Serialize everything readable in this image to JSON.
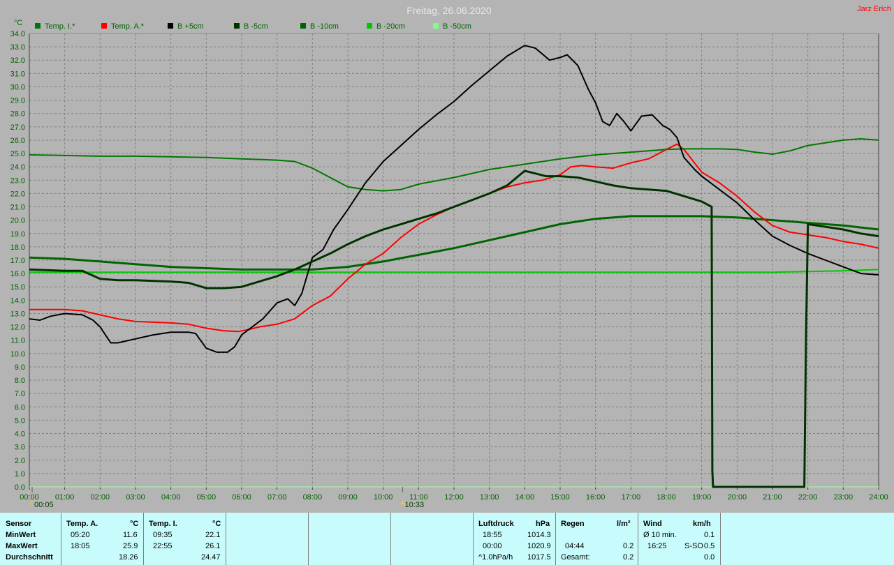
{
  "title": "Freitag, 26.06.2020",
  "author": "Jarz Erich",
  "colors": {
    "background": "#b4b4b4",
    "grid": "#808080",
    "axis_text": "#006400",
    "title_text": "#e8e8e8",
    "author_text": "#ff0000",
    "panel_bg": "#c8fcfc"
  },
  "chart_data": {
    "type": "line",
    "unit_label": "°C",
    "ylim": [
      0,
      34
    ],
    "y_ticks": [
      "0.0",
      "1.0",
      "2.0",
      "3.0",
      "4.0",
      "5.0",
      "6.0",
      "7.0",
      "8.0",
      "9.0",
      "10.0",
      "11.0",
      "12.0",
      "13.0",
      "14.0",
      "15.0",
      "16.0",
      "17.0",
      "18.0",
      "19.0",
      "20.0",
      "21.0",
      "22.0",
      "23.0",
      "24.0",
      "25.0",
      "26.0",
      "27.0",
      "28.0",
      "29.0",
      "30.0",
      "31.0",
      "32.0",
      "33.0",
      "34.0"
    ],
    "xlim": [
      0,
      24
    ],
    "x_ticks": [
      "00:00",
      "01:00",
      "02:00",
      "03:00",
      "04:00",
      "05:00",
      "06:00",
      "07:00",
      "08:00",
      "09:00",
      "10:00",
      "11:00",
      "12:00",
      "13:00",
      "14:00",
      "15:00",
      "16:00",
      "17:00",
      "18:00",
      "19:00",
      "20:00",
      "21:00",
      "22:00",
      "23:00",
      "24:00"
    ],
    "grid": true,
    "legend_position": "top",
    "markers": [
      {
        "label": "00:05",
        "x": 0.08
      },
      {
        "label": "10:33",
        "x": 10.55
      }
    ],
    "series": [
      {
        "name": "Temp. I.*",
        "color": "#007800",
        "width": 2,
        "points": [
          [
            0,
            24.9
          ],
          [
            1,
            24.85
          ],
          [
            2,
            24.8
          ],
          [
            3,
            24.8
          ],
          [
            4,
            24.75
          ],
          [
            5,
            24.7
          ],
          [
            6,
            24.6
          ],
          [
            7,
            24.5
          ],
          [
            7.5,
            24.4
          ],
          [
            8,
            23.9
          ],
          [
            8.5,
            23.2
          ],
          [
            9,
            22.5
          ],
          [
            9.5,
            22.3
          ],
          [
            10,
            22.2
          ],
          [
            10.5,
            22.3
          ],
          [
            11,
            22.7
          ],
          [
            12,
            23.2
          ],
          [
            13,
            23.8
          ],
          [
            14,
            24.2
          ],
          [
            15,
            24.6
          ],
          [
            16,
            24.9
          ],
          [
            17,
            25.1
          ],
          [
            17.5,
            25.2
          ],
          [
            18,
            25.3
          ],
          [
            18.5,
            25.35
          ],
          [
            19,
            25.35
          ],
          [
            19.5,
            25.35
          ],
          [
            20,
            25.3
          ],
          [
            20.5,
            25.1
          ],
          [
            21,
            24.95
          ],
          [
            21.5,
            25.2
          ],
          [
            22,
            25.6
          ],
          [
            22.5,
            25.8
          ],
          [
            23,
            26.0
          ],
          [
            23.5,
            26.1
          ],
          [
            24,
            26.0
          ]
        ]
      },
      {
        "name": "Temp. A.*",
        "color": "#ff0000",
        "width": 2,
        "points": [
          [
            0,
            13.3
          ],
          [
            1,
            13.3
          ],
          [
            1.5,
            13.2
          ],
          [
            2,
            12.9
          ],
          [
            2.5,
            12.6
          ],
          [
            3,
            12.4
          ],
          [
            4,
            12.3
          ],
          [
            4.5,
            12.2
          ],
          [
            5,
            11.9
          ],
          [
            5.5,
            11.7
          ],
          [
            5.9,
            11.65
          ],
          [
            6.2,
            11.8
          ],
          [
            6.5,
            12.0
          ],
          [
            7,
            12.2
          ],
          [
            7.5,
            12.6
          ],
          [
            7.8,
            13.2
          ],
          [
            8,
            13.6
          ],
          [
            8.5,
            14.3
          ],
          [
            9,
            15.6
          ],
          [
            9.5,
            16.7
          ],
          [
            10,
            17.5
          ],
          [
            10.5,
            18.7
          ],
          [
            11,
            19.7
          ],
          [
            11.5,
            20.4
          ],
          [
            12,
            21.0
          ],
          [
            12.5,
            21.5
          ],
          [
            13,
            22.0
          ],
          [
            13.5,
            22.5
          ],
          [
            14,
            22.8
          ],
          [
            14.5,
            23.0
          ],
          [
            15,
            23.4
          ],
          [
            15.3,
            24.0
          ],
          [
            15.6,
            24.1
          ],
          [
            16,
            24.0
          ],
          [
            16.5,
            23.9
          ],
          [
            17,
            24.3
          ],
          [
            17.5,
            24.6
          ],
          [
            18,
            25.3
          ],
          [
            18.3,
            25.7
          ],
          [
            18.5,
            25.3
          ],
          [
            19,
            23.6
          ],
          [
            19.5,
            22.8
          ],
          [
            20,
            21.8
          ],
          [
            20.5,
            20.6
          ],
          [
            21,
            19.6
          ],
          [
            21.5,
            19.1
          ],
          [
            22,
            18.9
          ],
          [
            22.5,
            18.7
          ],
          [
            23,
            18.4
          ],
          [
            23.5,
            18.2
          ],
          [
            24,
            17.9
          ]
        ]
      },
      {
        "name": "B +5cm",
        "color": "#000000",
        "width": 2,
        "points": [
          [
            0,
            12.6
          ],
          [
            0.3,
            12.5
          ],
          [
            0.6,
            12.8
          ],
          [
            1,
            13.0
          ],
          [
            1.5,
            12.9
          ],
          [
            1.8,
            12.5
          ],
          [
            2,
            12.0
          ],
          [
            2.2,
            11.2
          ],
          [
            2.3,
            10.8
          ],
          [
            2.5,
            10.8
          ],
          [
            3,
            11.1
          ],
          [
            3.5,
            11.4
          ],
          [
            4,
            11.6
          ],
          [
            4.5,
            11.6
          ],
          [
            4.7,
            11.5
          ],
          [
            5,
            10.4
          ],
          [
            5.3,
            10.1
          ],
          [
            5.6,
            10.1
          ],
          [
            5.8,
            10.5
          ],
          [
            6,
            11.4
          ],
          [
            6.3,
            12.0
          ],
          [
            6.6,
            12.6
          ],
          [
            7,
            13.8
          ],
          [
            7.3,
            14.1
          ],
          [
            7.5,
            13.6
          ],
          [
            7.7,
            14.5
          ],
          [
            8,
            17.2
          ],
          [
            8.3,
            17.8
          ],
          [
            8.6,
            19.3
          ],
          [
            9,
            20.8
          ],
          [
            9.5,
            22.8
          ],
          [
            10,
            24.4
          ],
          [
            10.5,
            25.6
          ],
          [
            11,
            26.8
          ],
          [
            11.5,
            27.9
          ],
          [
            12,
            28.9
          ],
          [
            12.5,
            30.1
          ],
          [
            13,
            31.2
          ],
          [
            13.5,
            32.3
          ],
          [
            14,
            33.1
          ],
          [
            14.3,
            32.9
          ],
          [
            14.7,
            32.0
          ],
          [
            15,
            32.2
          ],
          [
            15.2,
            32.4
          ],
          [
            15.5,
            31.6
          ],
          [
            15.8,
            29.8
          ],
          [
            16,
            28.8
          ],
          [
            16.2,
            27.4
          ],
          [
            16.4,
            27.1
          ],
          [
            16.6,
            28.0
          ],
          [
            16.8,
            27.4
          ],
          [
            17,
            26.7
          ],
          [
            17.3,
            27.8
          ],
          [
            17.6,
            27.9
          ],
          [
            17.9,
            27.1
          ],
          [
            18.1,
            26.8
          ],
          [
            18.3,
            26.2
          ],
          [
            18.5,
            24.7
          ],
          [
            18.8,
            23.8
          ],
          [
            19,
            23.3
          ],
          [
            19.5,
            22.3
          ],
          [
            20,
            21.3
          ],
          [
            20.5,
            20.0
          ],
          [
            21,
            18.8
          ],
          [
            21.5,
            18.1
          ],
          [
            22,
            17.5
          ],
          [
            22.5,
            17.0
          ],
          [
            23,
            16.5
          ],
          [
            23.5,
            16.0
          ],
          [
            24,
            15.9
          ]
        ]
      },
      {
        "name": "B -5cm",
        "color": "#003200",
        "width": 3,
        "points": [
          [
            0,
            16.3
          ],
          [
            1,
            16.2
          ],
          [
            1.5,
            16.2
          ],
          [
            2,
            15.6
          ],
          [
            2.5,
            15.5
          ],
          [
            3,
            15.5
          ],
          [
            4,
            15.4
          ],
          [
            4.5,
            15.3
          ],
          [
            5,
            14.9
          ],
          [
            5.5,
            14.9
          ],
          [
            6,
            15.0
          ],
          [
            6.5,
            15.4
          ],
          [
            7,
            15.8
          ],
          [
            7.5,
            16.3
          ],
          [
            8,
            16.9
          ],
          [
            8.5,
            17.5
          ],
          [
            9,
            18.2
          ],
          [
            9.5,
            18.8
          ],
          [
            10,
            19.3
          ],
          [
            10.5,
            19.7
          ],
          [
            11,
            20.1
          ],
          [
            11.5,
            20.5
          ],
          [
            12,
            21.0
          ],
          [
            12.5,
            21.5
          ],
          [
            13,
            22.0
          ],
          [
            13.5,
            22.6
          ],
          [
            14,
            23.7
          ],
          [
            14.3,
            23.5
          ],
          [
            14.6,
            23.3
          ],
          [
            15,
            23.3
          ],
          [
            15.5,
            23.2
          ],
          [
            16,
            22.9
          ],
          [
            16.5,
            22.6
          ],
          [
            17,
            22.4
          ],
          [
            17.5,
            22.3
          ],
          [
            18,
            22.2
          ],
          [
            18.5,
            21.8
          ],
          [
            19,
            21.4
          ],
          [
            19.28,
            21.0
          ],
          [
            19.3,
            1.2
          ],
          [
            19.32,
            0.0
          ],
          [
            21.9,
            0.0
          ],
          [
            21.95,
            11.5
          ],
          [
            22,
            19.7
          ],
          [
            22.5,
            19.5
          ],
          [
            23,
            19.3
          ],
          [
            23.5,
            19.0
          ],
          [
            24,
            18.8
          ]
        ]
      },
      {
        "name": "B -10cm",
        "color": "#006400",
        "width": 3,
        "points": [
          [
            0,
            17.2
          ],
          [
            1,
            17.1
          ],
          [
            2,
            16.9
          ],
          [
            3,
            16.7
          ],
          [
            4,
            16.5
          ],
          [
            5,
            16.4
          ],
          [
            6,
            16.3
          ],
          [
            7,
            16.3
          ],
          [
            8,
            16.3
          ],
          [
            9,
            16.5
          ],
          [
            10,
            16.9
          ],
          [
            11,
            17.4
          ],
          [
            12,
            17.9
          ],
          [
            13,
            18.5
          ],
          [
            14,
            19.1
          ],
          [
            15,
            19.7
          ],
          [
            16,
            20.1
          ],
          [
            17,
            20.3
          ],
          [
            18,
            20.3
          ],
          [
            19,
            20.3
          ],
          [
            20,
            20.2
          ],
          [
            21,
            20.0
          ],
          [
            22,
            19.8
          ],
          [
            23,
            19.6
          ],
          [
            24,
            19.3
          ]
        ]
      },
      {
        "name": "B -20cm",
        "color": "#00c800",
        "width": 2,
        "points": [
          [
            0,
            16.1
          ],
          [
            6,
            16.1
          ],
          [
            12,
            16.1
          ],
          [
            18,
            16.1
          ],
          [
            21,
            16.1
          ],
          [
            22,
            16.15
          ],
          [
            23,
            16.2
          ],
          [
            24,
            16.3
          ]
        ]
      },
      {
        "name": "B -50cm",
        "color": "#80ff80",
        "width": 1,
        "points": []
      }
    ]
  },
  "stats": {
    "sensor": {
      "header": "Sensor",
      "rows": [
        "MinWert",
        "MaxWert",
        "Durchschnitt"
      ]
    },
    "temp_a": {
      "header": "Temp. A.",
      "unit": "°C",
      "min_time": "05:20",
      "min_val": "11.6",
      "max_time": "18:05",
      "max_val": "25.9",
      "avg": "18.26"
    },
    "temp_i": {
      "header": "Temp. I.",
      "unit": "°C",
      "min_time": "09:35",
      "min_val": "22.1",
      "max_time": "22:55",
      "max_val": "26.1",
      "avg": "24.47"
    },
    "pressure": {
      "header": "Luftdruck",
      "unit": "hPa",
      "r1_label": "18:55",
      "r1_val": "1014.3",
      "r2_label": "00:00",
      "r2_val": "1020.9",
      "r3_label": "^1.0hPa/h",
      "r3_val": "1017.5"
    },
    "rain": {
      "header": "Regen",
      "unit": "l/m²",
      "r2_label": "04:44",
      "r2_val": "0.2",
      "r3_label": "Gesamt:",
      "r3_val": "0.2"
    },
    "wind": {
      "header": "Wind",
      "unit": "km/h",
      "r1_label": "Ø 10 min.",
      "r1_val": "0.1",
      "r2_label": "16:25",
      "r2_dir": "S-SO",
      "r2_val": "0.5",
      "r3_val": "0.0"
    }
  }
}
